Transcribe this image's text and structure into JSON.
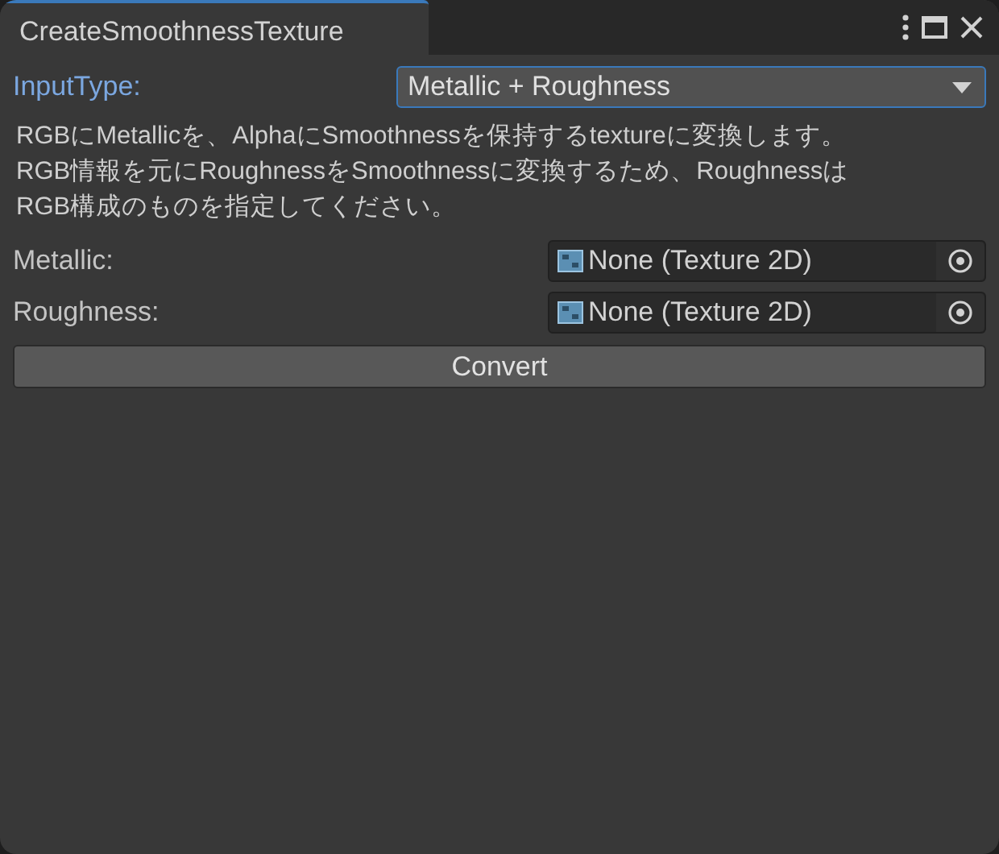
{
  "window": {
    "tab_title": "CreateSmoothnessTexture"
  },
  "input_type": {
    "label": "InputType:",
    "focused": true,
    "value": "Metallic + Roughness"
  },
  "description": [
    "RGBにMetallicを、AlphaにSmoothnessを保持するtextureに変換します。",
    "RGB情報を元にRoughnessをSmoothnessに変換するため、Roughnessは",
    "RGB構成のものを指定してください。"
  ],
  "fields": [
    {
      "label": "Metallic:",
      "value": "None (Texture 2D)"
    },
    {
      "label": "Roughness:",
      "value": "None (Texture 2D)"
    }
  ],
  "button": "Convert"
}
